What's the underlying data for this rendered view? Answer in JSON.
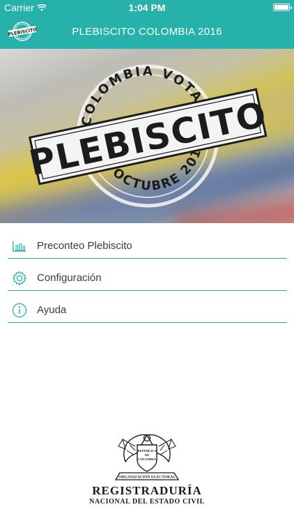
{
  "status_bar": {
    "carrier": "Carrier",
    "time": "1:04 PM"
  },
  "nav_bar": {
    "title": "PLEBISCITO COLOMBIA 2016",
    "logo_text": "PLEBISCITO"
  },
  "hero": {
    "top_arc": "COLOMBIA VOTA",
    "main": "PLEBISCITO",
    "bottom_arc": "2 OCTUBRE 2016"
  },
  "menu": [
    {
      "label": "Preconteo Plebiscito",
      "icon": "bar-chart-icon"
    },
    {
      "label": "Configuración",
      "icon": "gear-icon"
    },
    {
      "label": "Ayuda",
      "icon": "info-icon"
    }
  ],
  "footer": {
    "seal_top": "REPÚBLICA DE COLOMBIA",
    "seal_banner": "ORGANIZACIÓN ELECTORAL",
    "org_line1": "REGISTRADURÍA",
    "org_line2": "NACIONAL DEL ESTADO CIVIL"
  },
  "colors": {
    "accent": "#26b2ab",
    "text": "#3a3a3a",
    "stamp": "#1c1c1c"
  }
}
